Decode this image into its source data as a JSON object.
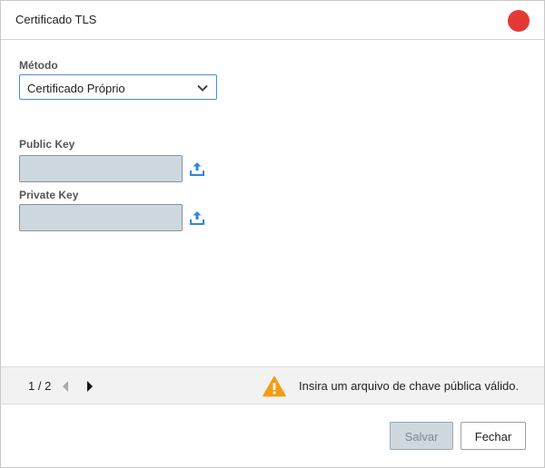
{
  "dialog": {
    "title": "Certificado TLS"
  },
  "form": {
    "method_label": "Método",
    "method_value": "Certificado Próprio",
    "public_key_label": "Public Key",
    "public_key_value": "",
    "private_key_label": "Private Key",
    "private_key_value": ""
  },
  "status": {
    "pager": "1 / 2",
    "message": "Insira um arquivo de chave pública válido."
  },
  "footer": {
    "save_label": "Salvar",
    "close_label": "Fechar"
  },
  "colors": {
    "accent": "#4a8fd4",
    "close_dot": "#e53935",
    "warning": "#f39c12",
    "field_bg": "#cdd8df"
  }
}
